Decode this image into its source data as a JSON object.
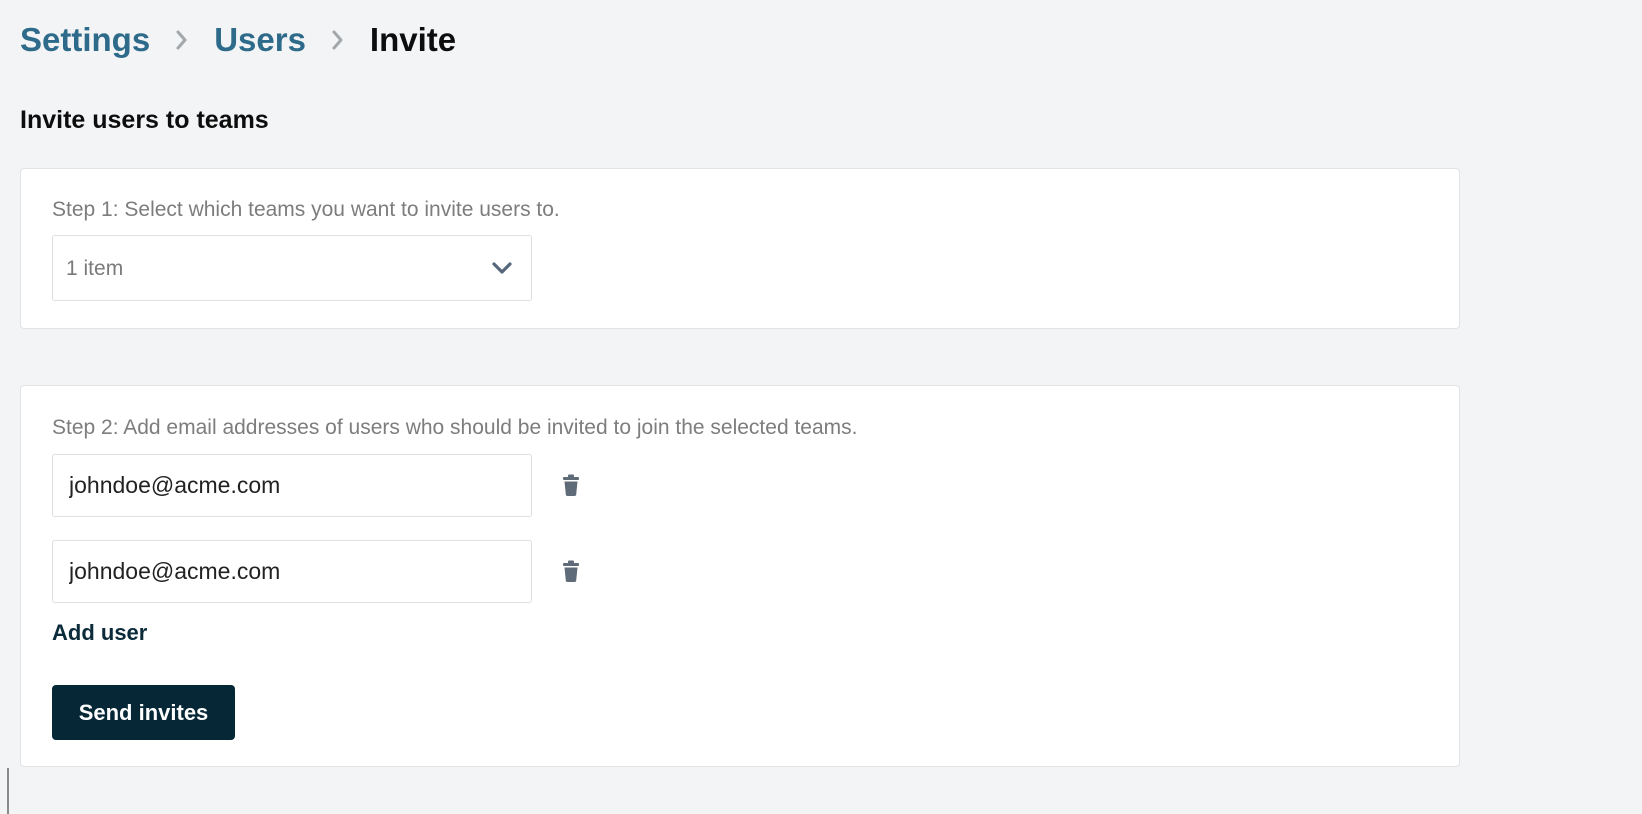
{
  "breadcrumb": {
    "items": [
      {
        "label": "Settings"
      },
      {
        "label": "Users"
      },
      {
        "label": "Invite"
      }
    ]
  },
  "page": {
    "title": "Invite users to teams"
  },
  "step1": {
    "label": "Step 1: Select which teams you want to invite users to.",
    "select_value": "1 item",
    "chevron_icon": "chevron-down-icon"
  },
  "step2": {
    "label": "Step 2: Add email addresses of users who should be invited to join the selected teams.",
    "emails": [
      {
        "value": "johndoe@acme.com",
        "delete_icon": "trash-icon"
      },
      {
        "value": "johndoe@acme.com",
        "delete_icon": "trash-icon"
      }
    ],
    "add_user_label": "Add user",
    "send_label": "Send invites"
  },
  "colors": {
    "background": "#f3f4f6",
    "breadcrumb_link": "#2e6b8a",
    "primary_button": "#062736",
    "muted_text": "#7d7d7d",
    "icon": "#5f6b78"
  }
}
